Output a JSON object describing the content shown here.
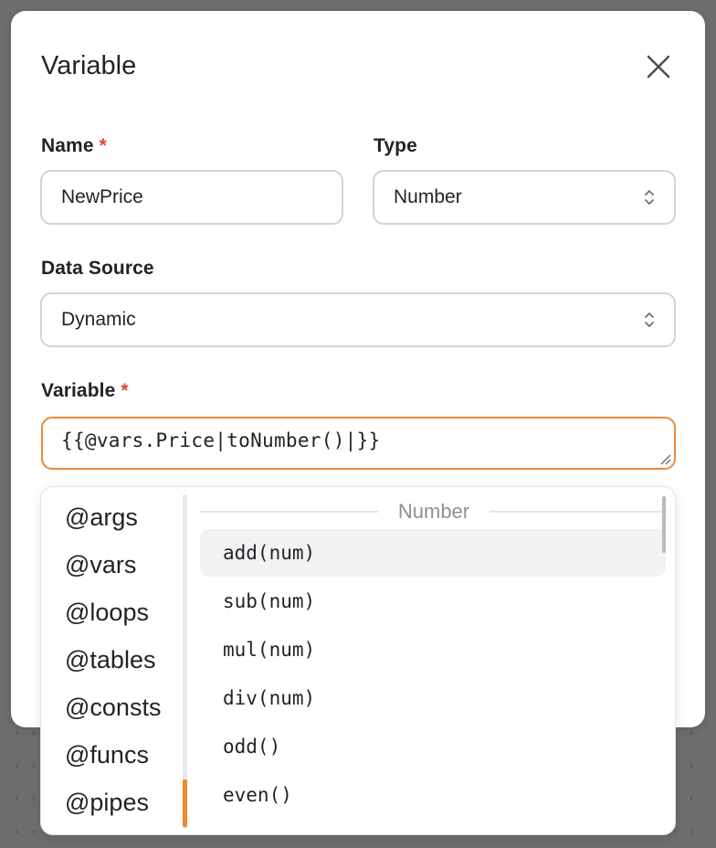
{
  "modal": {
    "title": "Variable",
    "close_icon": "close-icon"
  },
  "fields": {
    "name": {
      "label": "Name",
      "required_mark": "*",
      "value": "NewPrice"
    },
    "type": {
      "label": "Type",
      "value": "Number",
      "icon": "chevron-updown-icon"
    },
    "data_source": {
      "label": "Data Source",
      "value": "Dynamic",
      "icon": "chevron-updown-icon"
    },
    "variable": {
      "label": "Variable",
      "required_mark": "*",
      "value": "{{@vars.Price|toNumber()|}}"
    }
  },
  "autocomplete": {
    "namespaces": [
      "@args",
      "@vars",
      "@loops",
      "@tables",
      "@consts",
      "@funcs",
      "@pipes"
    ],
    "active_namespace": "@pipes",
    "group_label": "Number",
    "functions": [
      "add(num)",
      "sub(num)",
      "mul(num)",
      "div(num)",
      "odd()",
      "even()"
    ],
    "highlighted_function": "add(num)"
  },
  "colors": {
    "accent": "#f08a24",
    "focus_border": "#e88a3a",
    "required": "#e0452f",
    "backdrop": "#6e6e6e"
  }
}
